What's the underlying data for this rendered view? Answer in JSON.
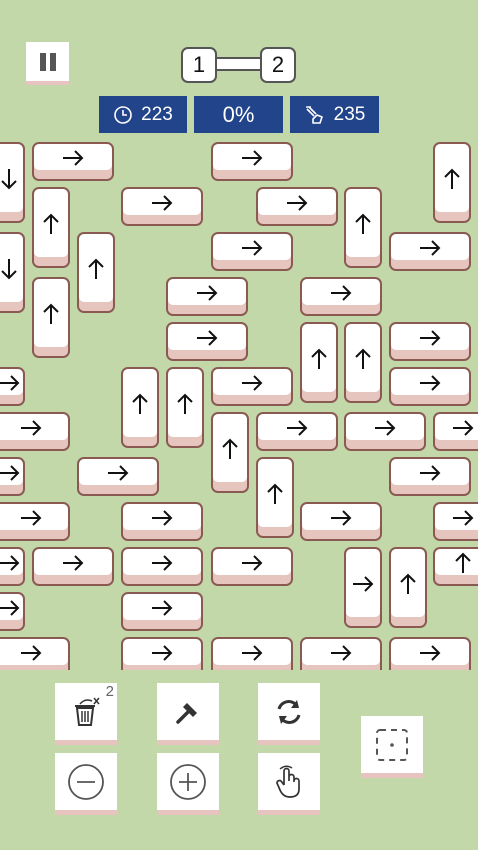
{
  "level": {
    "current": "1",
    "next": "2"
  },
  "stats": {
    "time": "223",
    "progress": "0%",
    "moves": "235"
  },
  "icons": {
    "timer": "clock-icon",
    "moves": "hand-swipe-icon",
    "pause": "pause-icon"
  },
  "board": {
    "tiles": [
      {
        "dir": "down"
      },
      {
        "dir": "right"
      },
      {
        "dir": "right"
      },
      {
        "dir": "up"
      },
      {
        "dir": "up"
      },
      {
        "dir": "right"
      },
      {
        "dir": "right"
      },
      {
        "dir": "up"
      },
      {
        "dir": "down"
      },
      {
        "dir": "up"
      },
      {
        "dir": "right"
      },
      {
        "dir": "right"
      },
      {
        "dir": "up"
      },
      {
        "dir": "right"
      },
      {
        "dir": "right"
      },
      {
        "dir": "right"
      },
      {
        "dir": "up"
      },
      {
        "dir": "up"
      },
      {
        "dir": "up"
      },
      {
        "dir": "right"
      },
      {
        "dir": "right"
      },
      {
        "dir": "right"
      },
      {
        "dir": "up"
      },
      {
        "dir": "right"
      },
      {
        "dir": "right"
      },
      {
        "dir": "right"
      },
      {
        "dir": "right"
      },
      {
        "dir": "right"
      },
      {
        "dir": "up"
      },
      {
        "dir": "right"
      },
      {
        "dir": "right"
      },
      {
        "dir": "right"
      },
      {
        "dir": "right"
      },
      {
        "dir": "right"
      },
      {
        "dir": "up"
      },
      {
        "dir": "up"
      },
      {
        "dir": "right"
      },
      {
        "dir": "right"
      },
      {
        "dir": "right"
      },
      {
        "dir": "right"
      },
      {
        "dir": "right"
      },
      {
        "dir": "right"
      },
      {
        "dir": "right"
      },
      {
        "dir": "right"
      },
      {
        "dir": "right"
      },
      {
        "dir": "right"
      },
      {
        "dir": "none"
      },
      {
        "dir": "none"
      },
      {
        "dir": "none"
      },
      {
        "dir": "none"
      }
    ]
  },
  "tools": {
    "remove_count": "2",
    "items": [
      {
        "icon": "trash-remove-icon"
      },
      {
        "icon": "hammer-icon"
      },
      {
        "icon": "refresh-icon"
      },
      {
        "icon": "zoom-out-icon"
      },
      {
        "icon": "zoom-in-icon"
      },
      {
        "icon": "hand-tap-icon"
      },
      {
        "icon": "select-area-icon"
      }
    ]
  }
}
